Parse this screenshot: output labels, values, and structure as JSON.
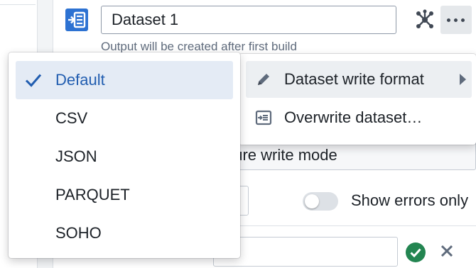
{
  "dataset": {
    "name": "Dataset 1",
    "helper_text": "Output will be created after first build"
  },
  "background": {
    "write_mode_text": "gure write mode",
    "toggle_label": "Show errors only",
    "toggle_on": false
  },
  "actions_menu": {
    "items": [
      {
        "label": "Dataset write format",
        "icon": "pencil-icon",
        "has_submenu": true,
        "highlighted": true
      },
      {
        "label": "Overwrite dataset…",
        "icon": "overwrite-dataset-icon",
        "has_submenu": false,
        "highlighted": false
      }
    ]
  },
  "format_menu": {
    "selected": "Default",
    "options": [
      "Default",
      "CSV",
      "JSON",
      "PARQUET",
      "SOHO"
    ]
  },
  "colors": {
    "accent": "#2d72d2",
    "selected_bg": "#e4ebf5",
    "selected_text": "#215db0",
    "success": "#238551"
  },
  "icons": {
    "dataset": "dataset-output-icon",
    "lineage": "lineage-graph-icon",
    "more": "more-horizontal-icon",
    "confirm": "tick-circle-icon",
    "cancel": "cross-icon",
    "selected_mark": "checkmark-icon"
  }
}
